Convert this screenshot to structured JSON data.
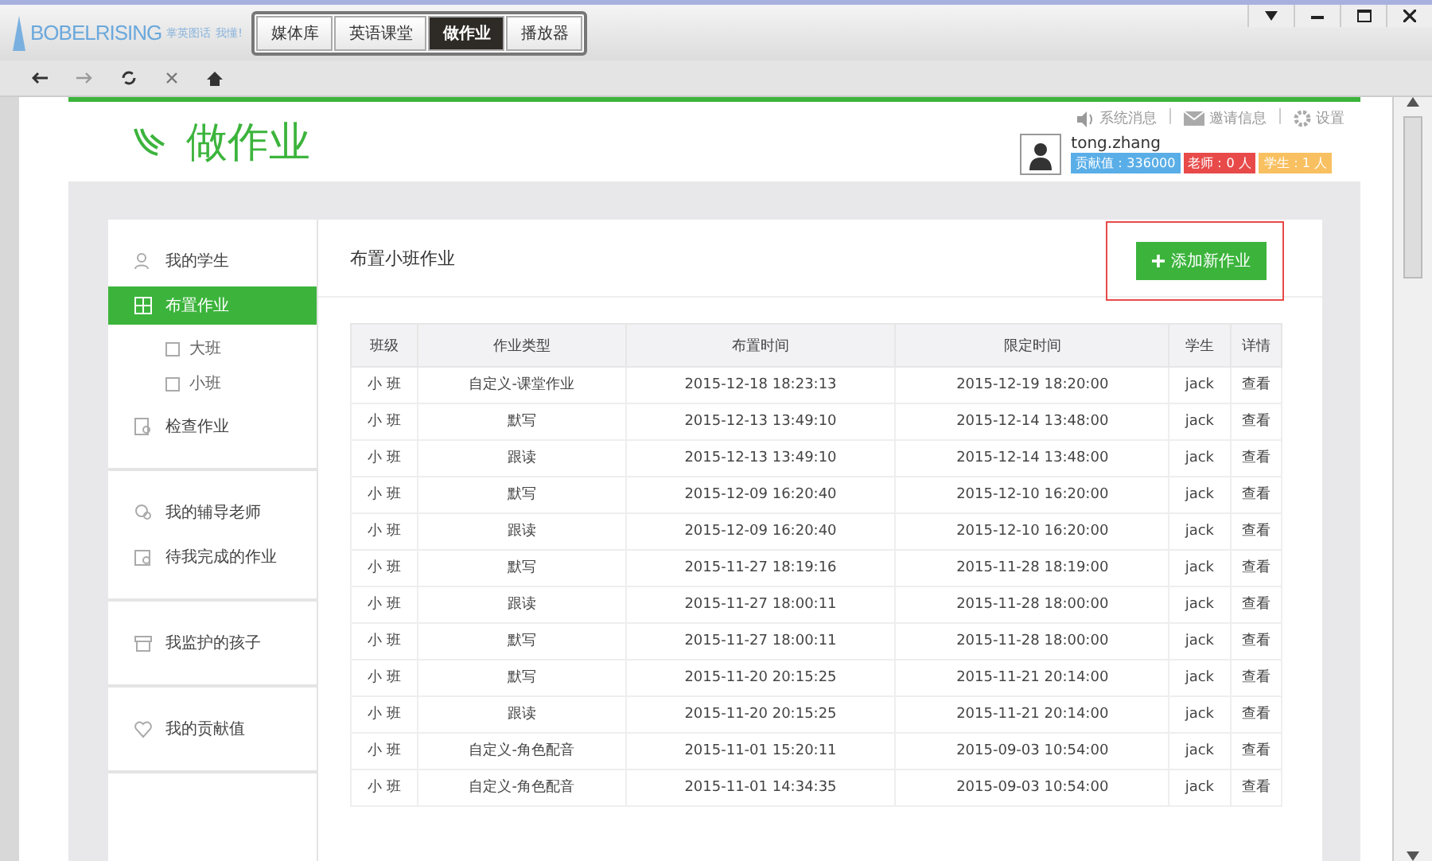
{
  "app_bar": {
    "logo_text": "BOBELRISING",
    "logo_slogan": "掌英图话",
    "logo_tagline": "我懂!",
    "tabs": [
      {
        "label": "媒体库",
        "selected": false
      },
      {
        "label": "英语课堂",
        "selected": false
      },
      {
        "label": "做作业",
        "selected": true
      },
      {
        "label": "播放器",
        "selected": false
      }
    ]
  },
  "header": {
    "title": "做作业",
    "links": [
      {
        "kind": "sound",
        "label": "系统消息"
      },
      {
        "kind": "mail",
        "label": "邀请信息"
      },
      {
        "kind": "gear",
        "label": "设置"
      }
    ],
    "user": {
      "name": "tong.zhang",
      "badges": [
        {
          "label": "贡献值：336000",
          "color": "#5aaee8"
        },
        {
          "label": "老师：0 人",
          "color": "#e84a4a"
        },
        {
          "label": "学生：1 人",
          "color": "#f8c060"
        }
      ]
    }
  },
  "sidebar": {
    "groups": [
      [
        {
          "kind": "students",
          "label": "我的学生",
          "selected": false
        },
        {
          "kind": "grid",
          "label": "布置作业",
          "selected": true,
          "children": [
            {
              "label": "大班",
              "selected": false
            },
            {
              "label": "小班",
              "selected": false
            }
          ]
        },
        {
          "kind": "check",
          "label": "检查作业",
          "selected": false
        }
      ],
      [
        {
          "kind": "tutor",
          "label": "我的辅导老师",
          "selected": false
        },
        {
          "kind": "calendar",
          "label": "待我完成的作业",
          "selected": false
        }
      ],
      [
        {
          "kind": "store",
          "label": "我监护的孩子",
          "selected": false
        }
      ],
      [
        {
          "kind": "heart",
          "label": "我的贡献值",
          "selected": false
        }
      ]
    ]
  },
  "main": {
    "title": "布置小班作业",
    "add_button": "添加新作业",
    "table": {
      "columns": [
        "班级",
        "作业类型",
        "布置时间",
        "限定时间",
        "学生",
        "详情"
      ],
      "rows": [
        [
          "小 班",
          "自定义-课堂作业",
          "2015-12-18 18:23:13",
          "2015-12-19 18:20:00",
          "jack",
          "查看"
        ],
        [
          "小 班",
          "默写",
          "2015-12-13 13:49:10",
          "2015-12-14 13:48:00",
          "jack",
          "查看"
        ],
        [
          "小 班",
          "跟读",
          "2015-12-13 13:49:10",
          "2015-12-14 13:48:00",
          "jack",
          "查看"
        ],
        [
          "小 班",
          "默写",
          "2015-12-09 16:20:40",
          "2015-12-10 16:20:00",
          "jack",
          "查看"
        ],
        [
          "小 班",
          "跟读",
          "2015-12-09 16:20:40",
          "2015-12-10 16:20:00",
          "jack",
          "查看"
        ],
        [
          "小 班",
          "默写",
          "2015-11-27 18:19:16",
          "2015-11-28 18:19:00",
          "jack",
          "查看"
        ],
        [
          "小 班",
          "跟读",
          "2015-11-27 18:00:11",
          "2015-11-28 18:00:00",
          "jack",
          "查看"
        ],
        [
          "小 班",
          "默写",
          "2015-11-27 18:00:11",
          "2015-11-28 18:00:00",
          "jack",
          "查看"
        ],
        [
          "小 班",
          "默写",
          "2015-11-20 20:15:25",
          "2015-11-21 20:14:00",
          "jack",
          "查看"
        ],
        [
          "小 班",
          "跟读",
          "2015-11-20 20:15:25",
          "2015-11-21 20:14:00",
          "jack",
          "查看"
        ],
        [
          "小 班",
          "自定义-角色配音",
          "2015-11-01 15:20:11",
          "2015-09-03 10:54:00",
          "jack",
          "查看"
        ],
        [
          "小 班",
          "自定义-角色配音",
          "2015-11-01 14:34:35",
          "2015-09-03 10:54:00",
          "jack",
          "查看"
        ]
      ]
    }
  }
}
